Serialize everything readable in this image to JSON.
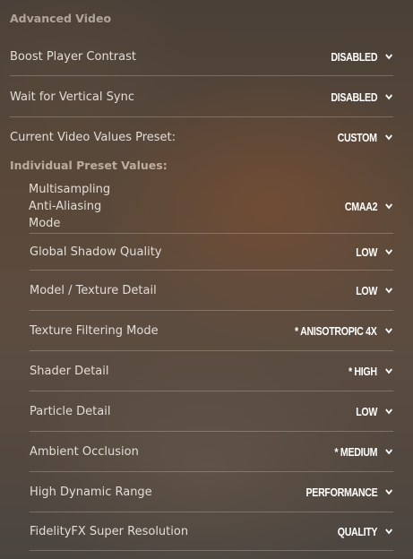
{
  "section_title": "Advanced Video",
  "top_settings": [
    {
      "label": "Boost Player Contrast",
      "value": "DISABLED"
    },
    {
      "label": "Wait for Vertical Sync",
      "value": "DISABLED"
    },
    {
      "label": "Current Video Values Preset:",
      "value": "CUSTOM"
    }
  ],
  "preset_heading": "Individual Preset Values:",
  "preset_settings": [
    {
      "label": "Multisampling\nAnti-Aliasing\nMode",
      "value": "CMAA2"
    },
    {
      "label": "Global Shadow Quality",
      "value": "LOW"
    },
    {
      "label": "Model / Texture Detail",
      "value": "LOW"
    },
    {
      "label": "Texture Filtering Mode",
      "value": "* ANISOTROPIC 4X"
    },
    {
      "label": "Shader Detail",
      "value": "* HIGH"
    },
    {
      "label": "Particle Detail",
      "value": "LOW"
    },
    {
      "label": "Ambient Occlusion",
      "value": "* MEDIUM"
    },
    {
      "label": "High Dynamic Range",
      "value": "PERFORMANCE"
    },
    {
      "label": "FidelityFX Super Resolution",
      "value": "QUALITY"
    }
  ],
  "icons": {
    "dropdown": "chevron-down-icon"
  }
}
